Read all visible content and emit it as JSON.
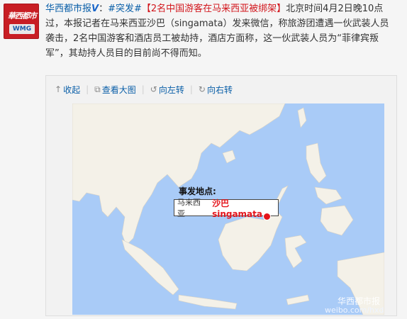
{
  "avatar": {
    "logo_text": "華西都市報",
    "badge": "WMG"
  },
  "post": {
    "author": "华西都市报",
    "verified": "V",
    "colon": "：",
    "topic": "#突发#",
    "title": "【2名中国游客在马来西亚被绑架】",
    "body": "北京时间4月2日晚10点过，本报记者在马来西亚沙巴（singamata）发来微信，称旅游团遭遇一伙武装人员袭击，2名中国游客和酒店员工被劫持，酒店方面称，这一伙武装人员为“菲律宾叛军”，其劫持人员目的目前尚不得而知。"
  },
  "toolbar": {
    "collapse": "收起",
    "view_large": "查看大图",
    "rotate_left": "向左转",
    "rotate_right": "向右转"
  },
  "map": {
    "callout_title": "事发地点:",
    "callout_country": "马来西亚",
    "callout_place": "沙巴singamata",
    "watermark_account": "华西都市报",
    "watermark_url": "weibo.com/hxdsb",
    "colors": {
      "sea": "#a9cbf7",
      "land": "#f4f1e8",
      "highlight": "#e4141b"
    }
  }
}
